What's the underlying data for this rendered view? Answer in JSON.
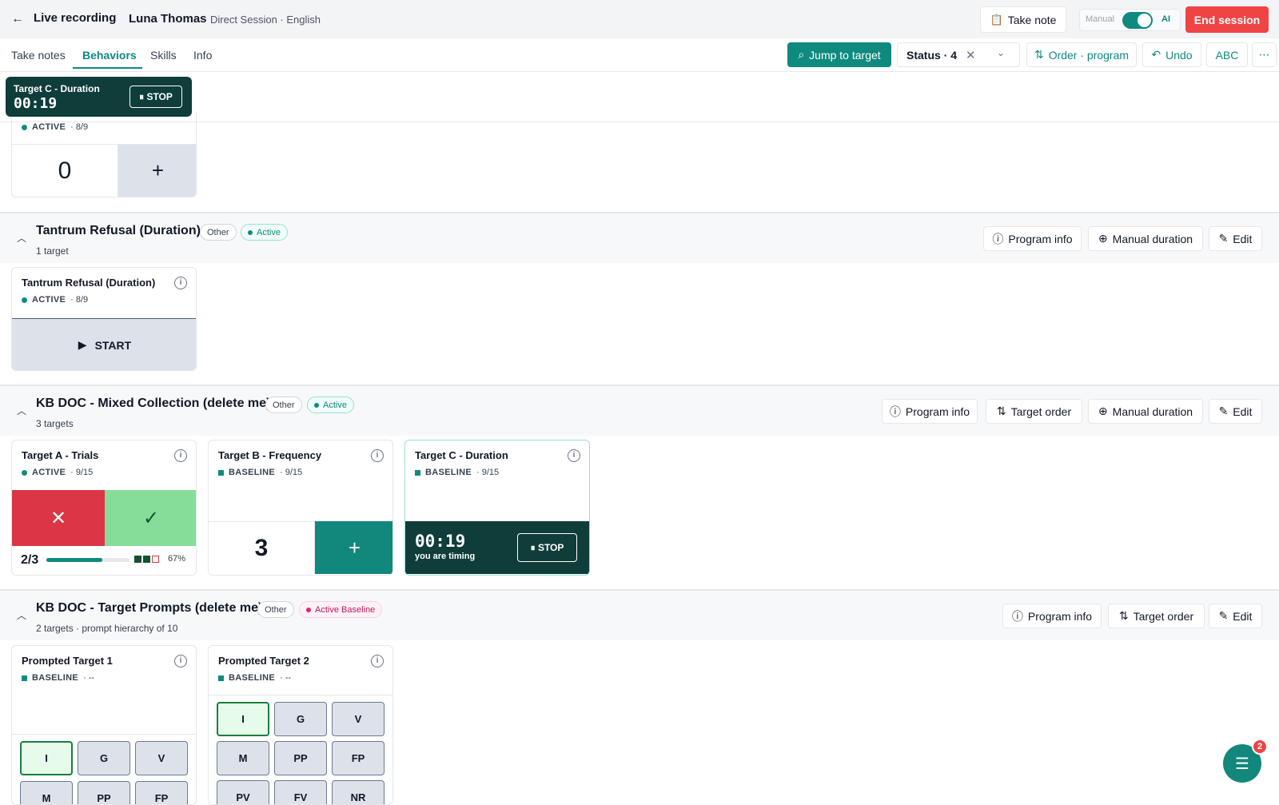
{
  "header": {
    "title": "Live recording",
    "client_name": "Luna Thomas",
    "session_meta": "Direct Session · English",
    "take_note_label": "Take note",
    "mode_manual_label": "Manual",
    "mode_ai_label": "AI",
    "end_session_label": "End session"
  },
  "tabs": [
    {
      "label": "Take notes"
    },
    {
      "label": "Behaviors",
      "active": true
    },
    {
      "label": "Skills"
    },
    {
      "label": "Info"
    }
  ],
  "toolbar": {
    "jump_label": "Jump to target",
    "status_filter_label": "Status · 4",
    "order_label": "Order · program",
    "undo_label": "Undo",
    "abc_label": "ABC",
    "more_label": "⋯"
  },
  "floating_timer": {
    "label": "Target C - Duration",
    "time": "00:19",
    "stop_label": "STOP"
  },
  "top_card": {
    "status": "ACTIVE",
    "session": "· 8/9",
    "count": "0",
    "plus": "+"
  },
  "sections": [
    {
      "title": "Tantrum Refusal (Duration)",
      "category": "Other",
      "status": "Active",
      "subtitle": "1 target",
      "buttons": [
        "Program info",
        "Manual duration",
        "Edit"
      ],
      "card": {
        "title": "Tantrum Refusal (Duration)",
        "status": "ACTIVE",
        "session": "· 8/9",
        "start_label": "START"
      }
    },
    {
      "title": "KB DOC - Mixed Collection (delete me)",
      "category": "Other",
      "status": "Active",
      "subtitle": "3 targets",
      "buttons": [
        "Program info",
        "Target order",
        "Manual duration",
        "Edit"
      ],
      "cards": [
        {
          "title": "Target A - Trials",
          "status": "ACTIVE",
          "session": "· 9/15",
          "score": "2/3",
          "progress": 0.67,
          "pct": "67%"
        },
        {
          "title": "Target B - Frequency",
          "status": "BASELINE",
          "session": "· 9/15",
          "count": "3",
          "plus": "+"
        },
        {
          "title": "Target C - Duration",
          "status": "BASELINE",
          "session": "· 9/15",
          "time": "00:19",
          "timing_label": "you are timing",
          "stop_label": "STOP"
        }
      ]
    },
    {
      "title": "KB DOC - Target Prompts (delete me)",
      "category": "Other",
      "status": "Active Baseline",
      "subtitle": "2 targets · prompt hierarchy of 10",
      "buttons": [
        "Program info",
        "Target order",
        "Edit"
      ],
      "cards": [
        {
          "title": "Prompted Target 1",
          "status": "BASELINE",
          "session": "· --"
        },
        {
          "title": "Prompted Target 2",
          "status": "BASELINE",
          "session": "· --"
        }
      ],
      "prompts": [
        "I",
        "G",
        "V",
        "M",
        "PP",
        "FP",
        "PV",
        "FV",
        "NR"
      ]
    }
  ],
  "fab": {
    "badge": "2"
  },
  "colors": {
    "accent": "#0f8a7e",
    "danger": "#ef4444",
    "timer_dark": "#0f3d3a"
  }
}
